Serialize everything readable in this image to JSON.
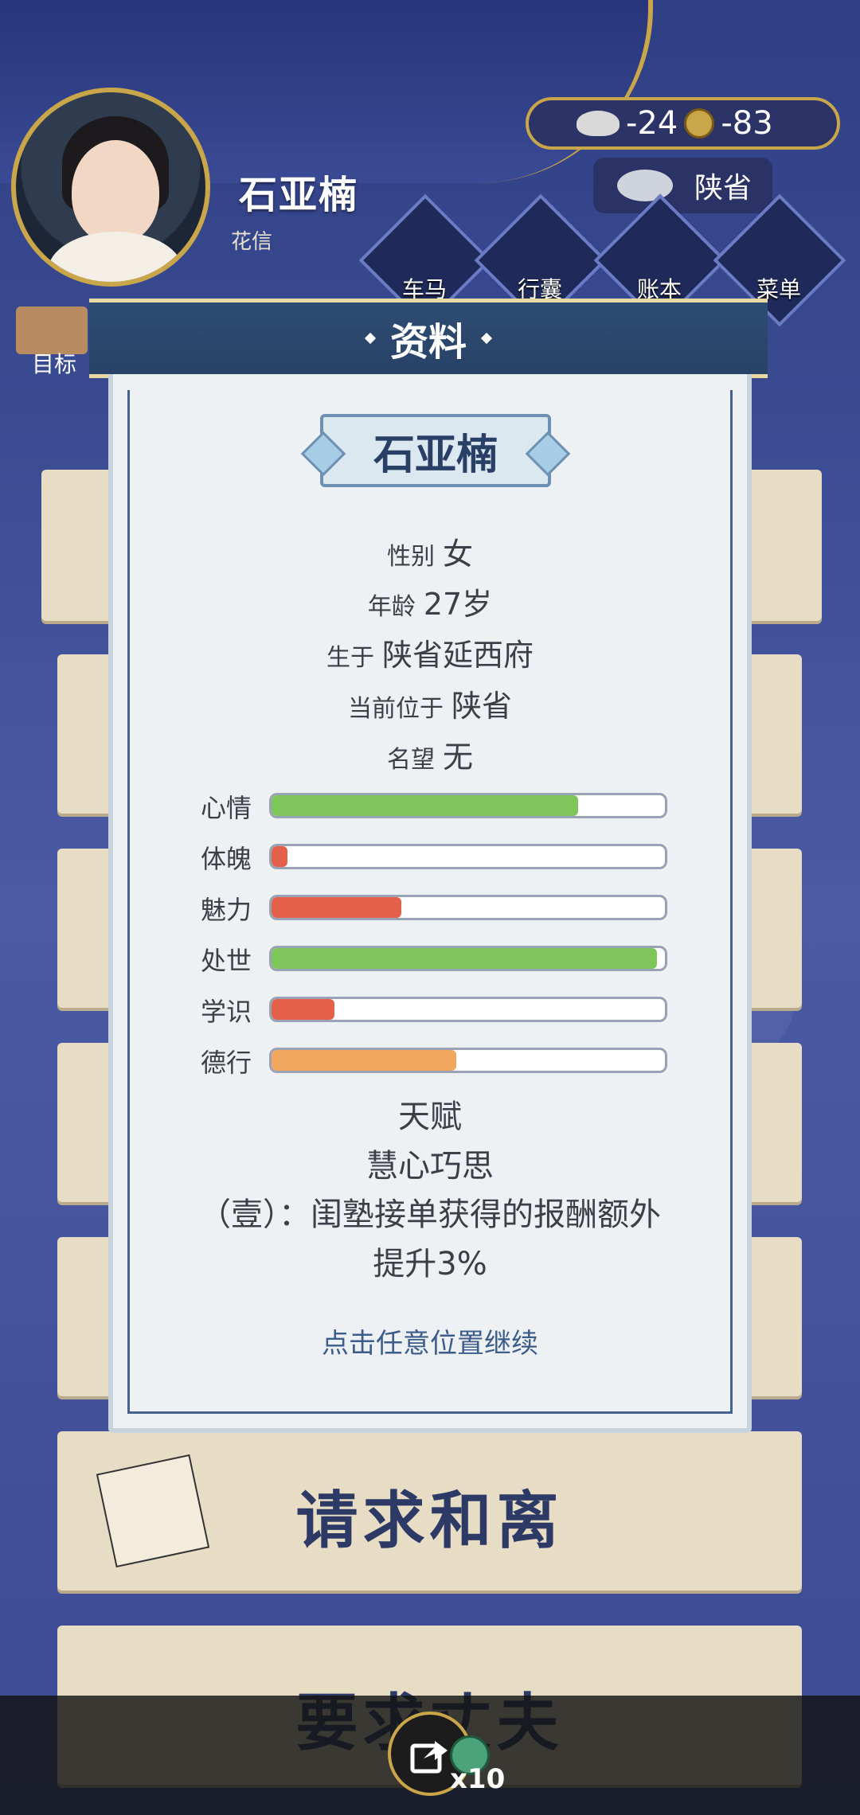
{
  "player": {
    "name": "石亚楠",
    "subtitle": "花信"
  },
  "currency": {
    "silver": "-24",
    "coins": "-83"
  },
  "location": "陕省",
  "menu": [
    {
      "label": "车马",
      "icon": "carriage-icon"
    },
    {
      "label": "行囊",
      "icon": "bag-icon"
    },
    {
      "label": "账本",
      "icon": "ledger-icon"
    },
    {
      "label": "菜单",
      "icon": "menu-dots-icon"
    }
  ],
  "goal_label": "目标",
  "cards": {
    "divorce": "请求和离",
    "husband": "要求丈夫"
  },
  "share": {
    "count": "x10"
  },
  "dialog": {
    "title": "资料",
    "name": "石亚楠",
    "info": [
      {
        "label": "性别",
        "value": "女"
      },
      {
        "label": "年龄",
        "value": "27岁"
      },
      {
        "label": "生于",
        "value": "陕省延西府"
      },
      {
        "label": "当前位于",
        "value": "陕省"
      },
      {
        "label": "名望",
        "value": "无"
      }
    ],
    "stats": [
      {
        "label": "心情",
        "percent": 78,
        "color": "#7ec65a"
      },
      {
        "label": "体魄",
        "percent": 4,
        "color": "#e5604a"
      },
      {
        "label": "魅力",
        "percent": 33,
        "color": "#e5604a"
      },
      {
        "label": "处世",
        "percent": 98,
        "color": "#7ec65a"
      },
      {
        "label": "学识",
        "percent": 16,
        "color": "#e5604a"
      },
      {
        "label": "德行",
        "percent": 47,
        "color": "#f2a65e"
      }
    ],
    "talent_title": "天赋",
    "talent_name": "慧心巧思",
    "talent_desc_line1": "（壹）：闺塾接单获得的报酬额外",
    "talent_desc_line2": "提升3%",
    "continue_hint": "点击任意位置继续"
  }
}
